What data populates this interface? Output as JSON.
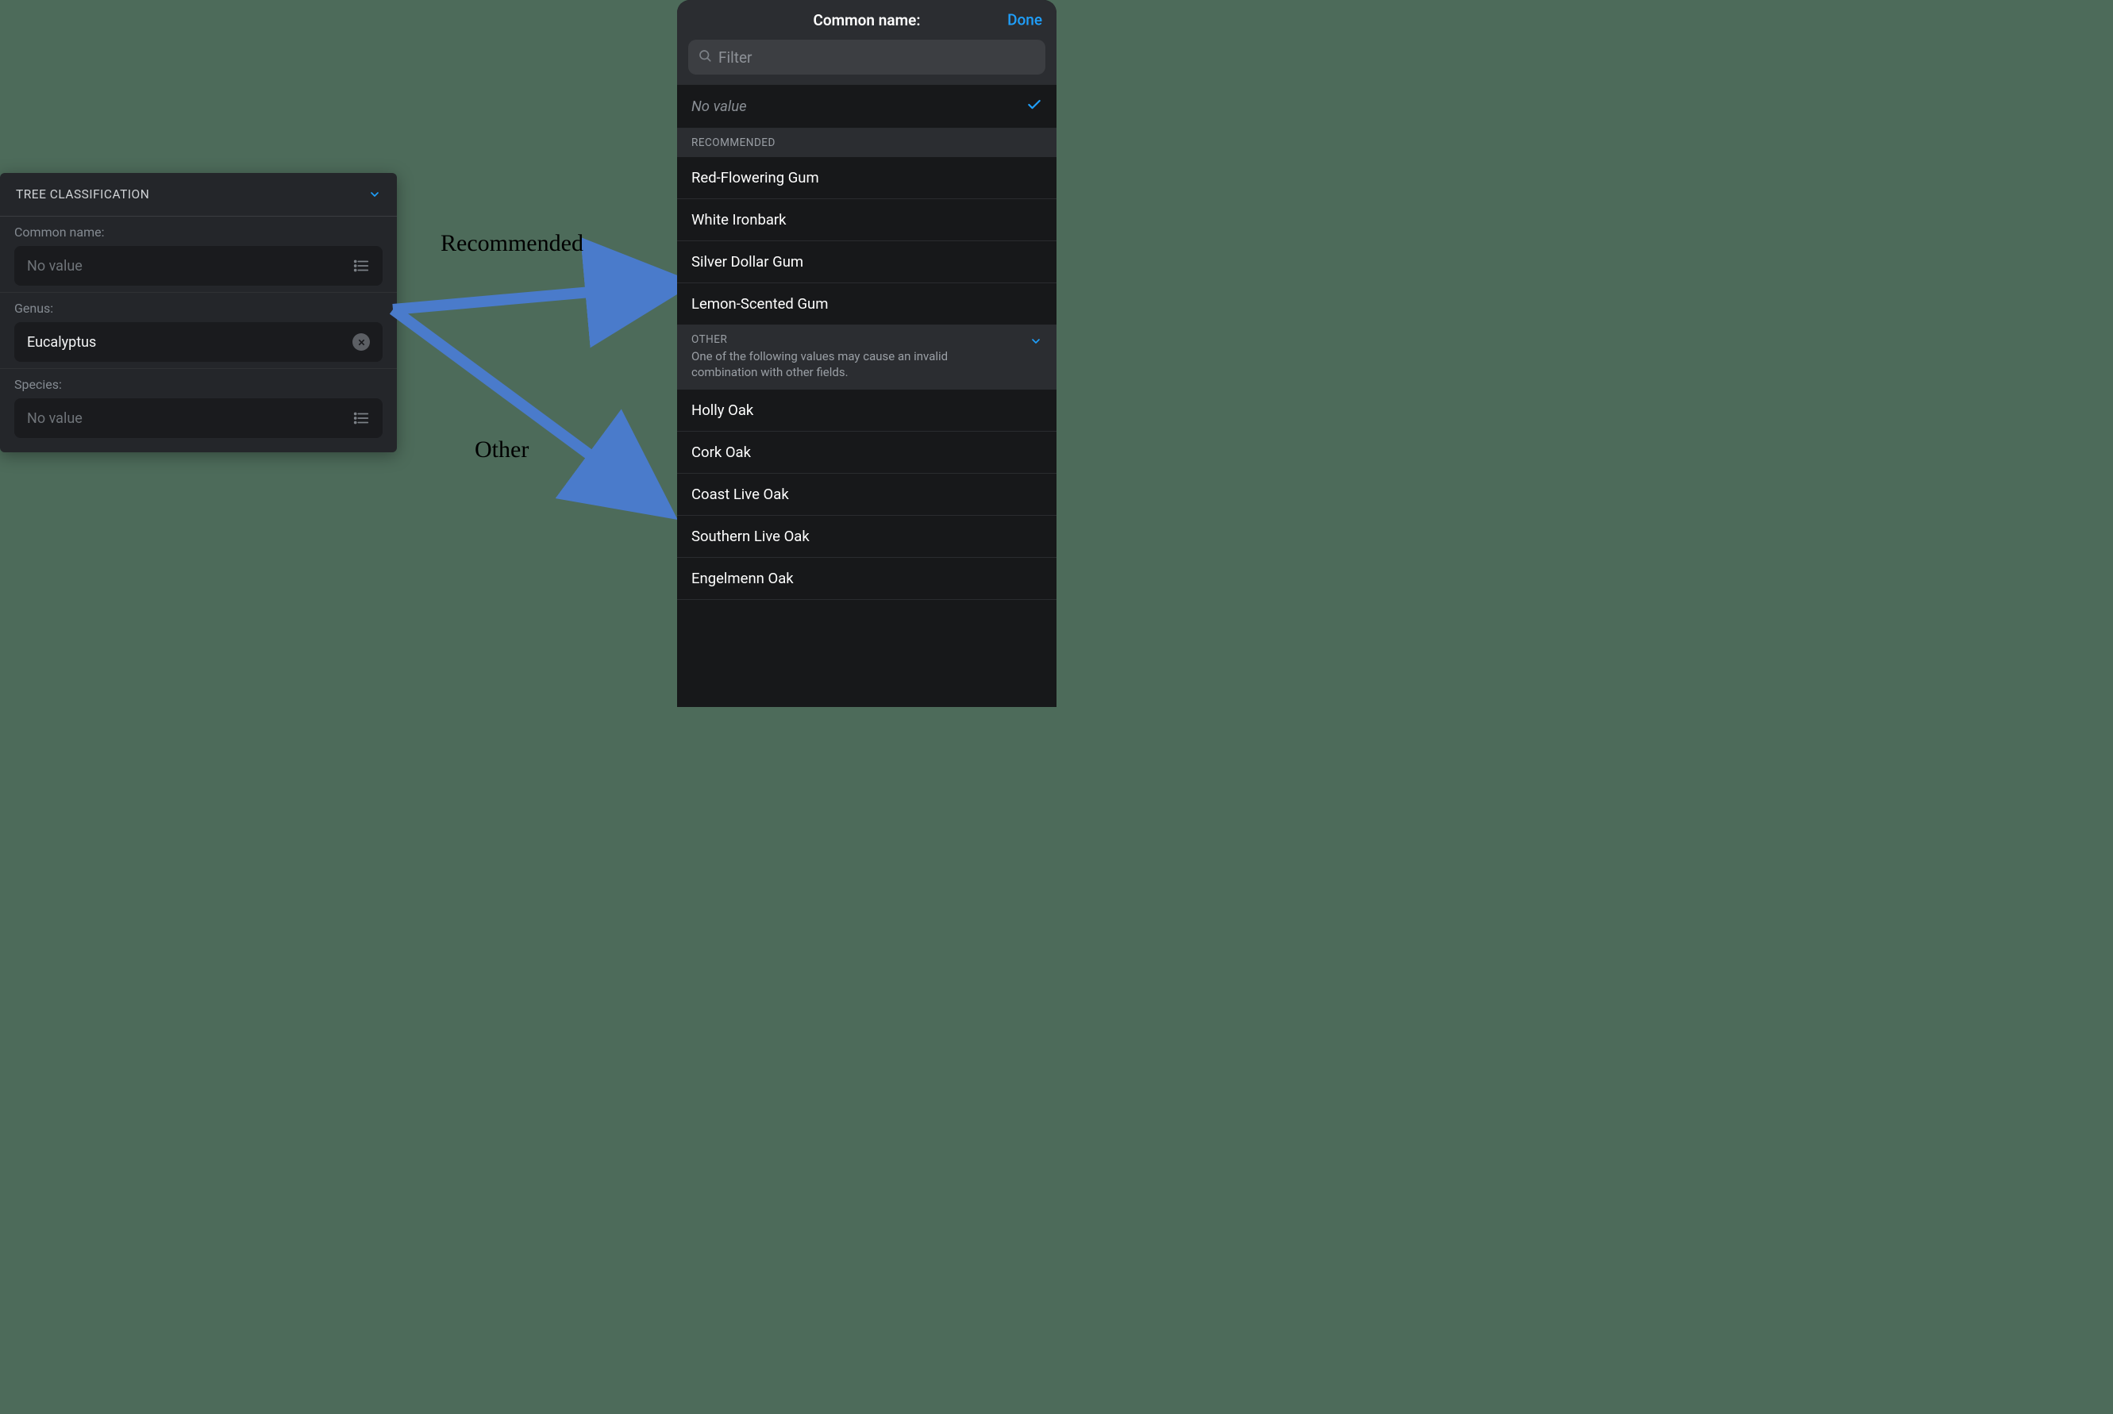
{
  "form": {
    "group_title": "TREE CLASSIFICATION",
    "fields": {
      "common_name": {
        "label": "Common name:",
        "value": "No value",
        "filled": false
      },
      "genus": {
        "label": "Genus:",
        "value": "Eucalyptus",
        "filled": true
      },
      "species": {
        "label": "Species:",
        "value": "No value",
        "filled": false
      }
    }
  },
  "annotations": {
    "recommended": "Recommended",
    "other": "Other"
  },
  "picker": {
    "title": "Common name:",
    "done": "Done",
    "filter_placeholder": "Filter",
    "no_value": "No value",
    "sections": {
      "recommended": {
        "header": "RECOMMENDED",
        "items": [
          "Red-Flowering Gum",
          "White Ironbark",
          "Silver Dollar Gum",
          "Lemon-Scented Gum"
        ]
      },
      "other": {
        "header": "OTHER",
        "sub": "One of the following values may cause an invalid combination with other fields.",
        "items": [
          "Holly Oak",
          "Cork Oak",
          "Coast Live Oak",
          "Southern Live Oak",
          "Engelmenn Oak"
        ]
      }
    }
  },
  "colors": {
    "accent": "#1f9ffb",
    "arrow": "#4a7bcb"
  }
}
